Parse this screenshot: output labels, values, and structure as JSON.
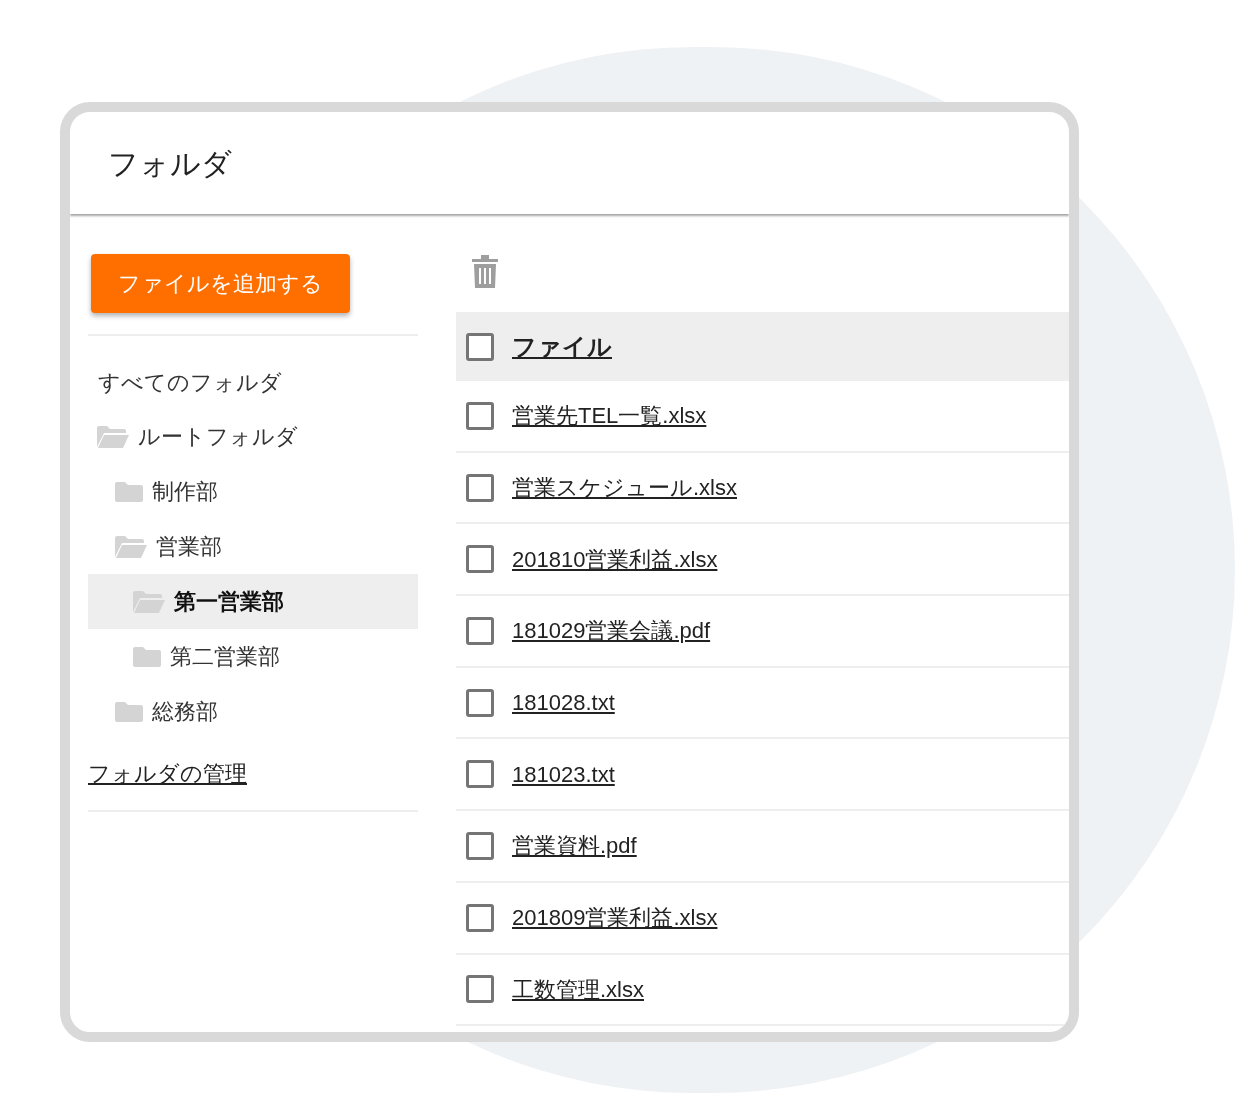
{
  "window": {
    "title": "フォルダ"
  },
  "sidebar": {
    "add_button": "ファイルを追加する",
    "all_folders": "すべてのフォルダ",
    "tree": [
      {
        "label": "ルートフォルダ",
        "open": true,
        "selected": false,
        "children": [
          {
            "label": "制作部",
            "open": false,
            "selected": false
          },
          {
            "label": "営業部",
            "open": true,
            "selected": false,
            "children": [
              {
                "label": "第一営業部",
                "open": true,
                "selected": true
              },
              {
                "label": "第二営業部",
                "open": false,
                "selected": false
              }
            ]
          },
          {
            "label": "総務部",
            "open": false,
            "selected": false
          }
        ]
      }
    ],
    "manage_link": "フォルダの管理"
  },
  "table": {
    "header": {
      "label": "ファイル",
      "checked": false
    },
    "rows": [
      {
        "name": "営業先TEL一覧.xlsx",
        "checked": false
      },
      {
        "name": "営業スケジュール.xlsx",
        "checked": false
      },
      {
        "name": "201810営業利益.xlsx",
        "checked": false
      },
      {
        "name": "181029営業会議.pdf",
        "checked": false
      },
      {
        "name": "181028.txt",
        "checked": false
      },
      {
        "name": "181023.txt",
        "checked": false
      },
      {
        "name": "営業資料.pdf",
        "checked": false
      },
      {
        "name": "201809営業利益.xlsx",
        "checked": false
      },
      {
        "name": "工数管理.xlsx",
        "checked": false
      }
    ]
  }
}
